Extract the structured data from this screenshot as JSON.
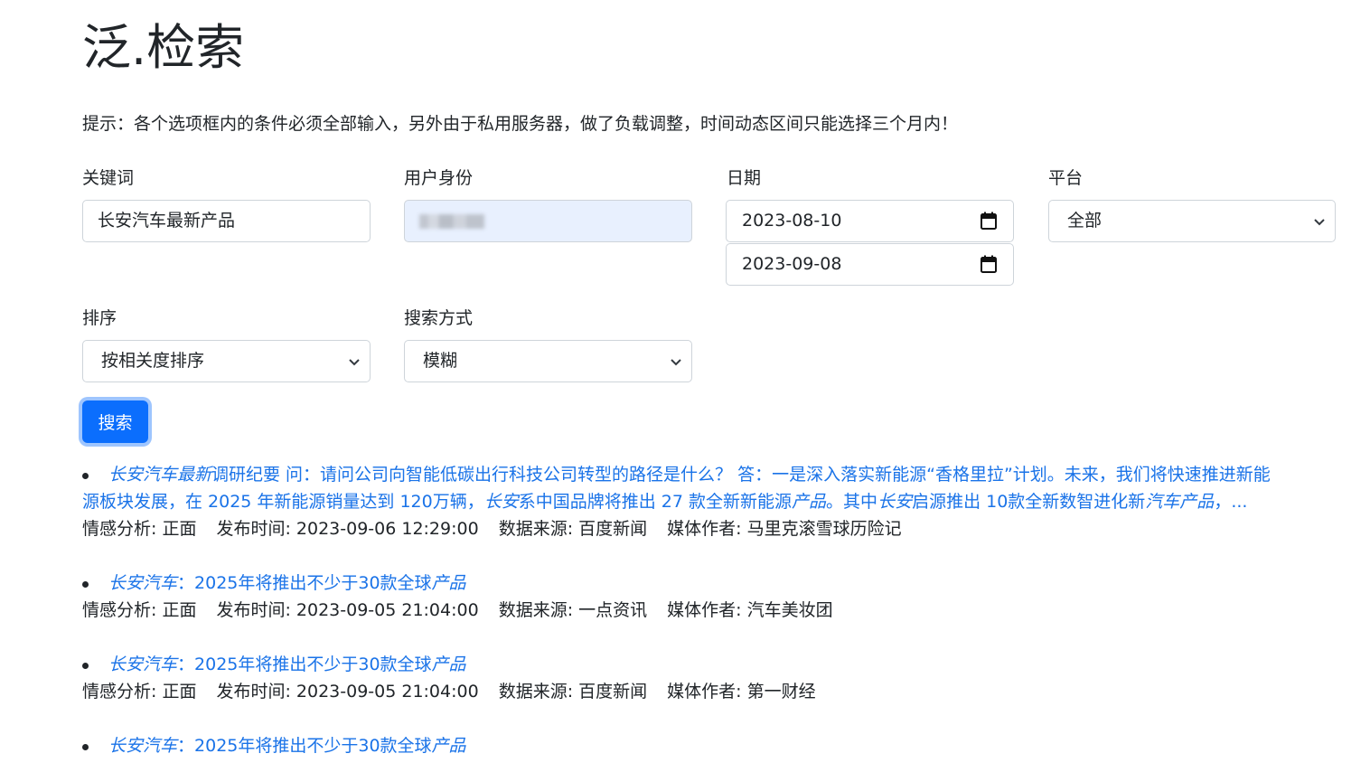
{
  "title": "泛.检索",
  "hint": "提示：各个选项框内的条件必须全部输入，另外由于私用服务器，做了负载调整，时间动态区间只能选择三个月内！",
  "form": {
    "keyword": {
      "label": "关键词",
      "value": "长安汽车最新产品"
    },
    "identity": {
      "label": "用户身份",
      "value": ""
    },
    "date": {
      "label": "日期",
      "start": "2023-08-10",
      "end": "2023-09-08"
    },
    "platform": {
      "label": "平台",
      "selected": "全部"
    },
    "sort": {
      "label": "排序",
      "selected": "按相关度排序"
    },
    "mode": {
      "label": "搜索方式",
      "selected": "模糊"
    },
    "search_button": "搜索"
  },
  "meta_labels": {
    "sentiment": "情感分析: ",
    "time": "发布时间: ",
    "source": "数据来源: ",
    "author": "媒体作者: "
  },
  "results": [
    {
      "title_parts": [
        {
          "text": "长安汽车最新",
          "em": true
        },
        {
          "text": "调研纪要 问：请问公司向智能低碳出行科技公司转型的路径是什么？ 答：一是深入落实新能源“香格里拉”计划。未来，我们将快速推进新能",
          "em": false
        }
      ],
      "title_line2_parts": [
        {
          "text": "源板块发展，在 2025 年新能源销量达到 120万辆，",
          "em": false
        },
        {
          "text": "长安",
          "em": true
        },
        {
          "text": "系中国品牌将推出 27 款全新新能源",
          "em": false
        },
        {
          "text": "产品",
          "em": true
        },
        {
          "text": "。其中",
          "em": false
        },
        {
          "text": "长安",
          "em": true
        },
        {
          "text": "启源推出 10款全新数智进化新",
          "em": false
        },
        {
          "text": "汽车产品",
          "em": true
        },
        {
          "text": "，...",
          "em": false
        }
      ],
      "sentiment": "正面",
      "time": "2023-09-06 12:29:00",
      "source": "百度新闻",
      "author": "马里克滚雪球历险记"
    },
    {
      "title_parts": [
        {
          "text": "长安汽车",
          "em": true
        },
        {
          "text": "：2025年将推出不少于30款全球",
          "em": false
        },
        {
          "text": "产品",
          "em": true
        }
      ],
      "sentiment": "正面",
      "time": "2023-09-05 21:04:00",
      "source": "一点资讯",
      "author": "汽车美妆团"
    },
    {
      "title_parts": [
        {
          "text": "长安汽车",
          "em": true
        },
        {
          "text": "：2025年将推出不少于30款全球",
          "em": false
        },
        {
          "text": "产品",
          "em": true
        }
      ],
      "sentiment": "正面",
      "time": "2023-09-05 21:04:00",
      "source": "百度新闻",
      "author": "第一财经"
    },
    {
      "title_parts": [
        {
          "text": "长安汽车",
          "em": true
        },
        {
          "text": "：2025年将推出不少于30款全球",
          "em": false
        },
        {
          "text": "产品",
          "em": true
        }
      ]
    }
  ]
}
